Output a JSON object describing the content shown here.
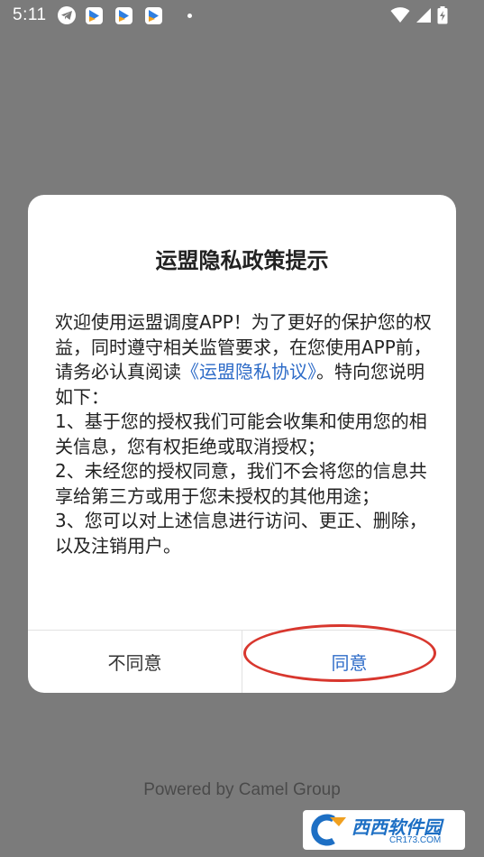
{
  "status_bar": {
    "time": "5:11",
    "icons": [
      "telegram-icon",
      "app-icon",
      "app-icon",
      "app-icon",
      "dot-icon",
      "wifi-icon",
      "signal-icon",
      "battery-charging-icon"
    ]
  },
  "dialog": {
    "title": "运盟隐私政策提示",
    "body": {
      "intro_before_link": "欢迎使用运盟调度APP！为了更好的保护您的权益，同时遵守相关监管要求，在您使用APP前，请务必认真阅读",
      "link_text": "《运盟隐私协议》",
      "intro_after_link": "。特向您说明如下：",
      "items": [
        "1、基于您的授权我们可能会收集和使用您的相关信息，您有权拒绝或取消授权；",
        "2、未经您的授权同意，我们不会将您的信息共享给第三方或用于您未授权的其他用途；",
        "3、您可以对上述信息进行访问、更正、删除，以及注销用户。"
      ]
    },
    "buttons": {
      "disagree": "不同意",
      "agree": "同意"
    }
  },
  "footer": {
    "text": "Powered by Camel Group"
  },
  "watermark": {
    "name": "西西软件园",
    "site": "CR173.COM"
  },
  "colors": {
    "overlay": "#7b7b7b",
    "link": "#2e6cc8",
    "highlight": "#d8372e"
  }
}
